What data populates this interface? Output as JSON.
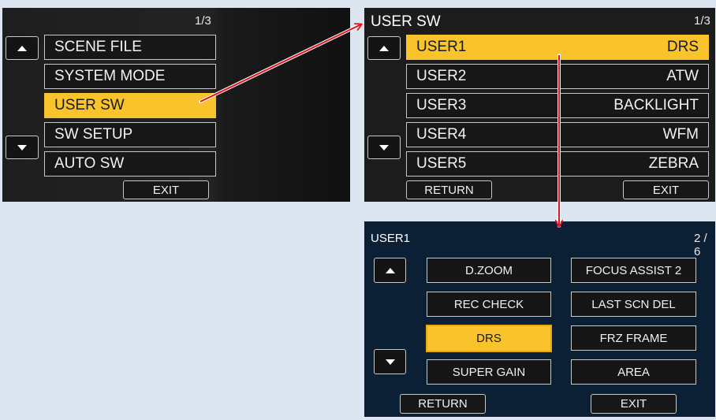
{
  "menu": {
    "page": "1/3",
    "items": [
      {
        "label": "SCENE FILE"
      },
      {
        "label": "SYSTEM MODE"
      },
      {
        "label": "USER SW"
      },
      {
        "label": "SW SETUP"
      },
      {
        "label": "AUTO SW"
      }
    ],
    "selected_index": 2,
    "exit_label": "EXIT",
    "up_icon": "triangle-up-icon",
    "down_icon": "triangle-down-icon"
  },
  "user_sw": {
    "title": "USER SW",
    "page": "1/3",
    "rows": [
      {
        "name": "USER1",
        "value": "DRS"
      },
      {
        "name": "USER2",
        "value": "ATW"
      },
      {
        "name": "USER3",
        "value": "BACKLIGHT"
      },
      {
        "name": "USER4",
        "value": "WFM"
      },
      {
        "name": "USER5",
        "value": "ZEBRA"
      }
    ],
    "selected_index": 0,
    "return_label": "RETURN",
    "exit_label": "EXIT"
  },
  "user1": {
    "title": "USER1",
    "page": "2 / 6",
    "left_items": [
      {
        "label": "D.ZOOM"
      },
      {
        "label": "REC CHECK"
      },
      {
        "label": "DRS"
      },
      {
        "label": "SUPER GAIN"
      }
    ],
    "right_items": [
      {
        "label": "FOCUS ASSIST 2"
      },
      {
        "label": "LAST SCN DEL"
      },
      {
        "label": "FRZ FRAME"
      },
      {
        "label": "AREA"
      }
    ],
    "selected": "DRS",
    "return_label": "RETURN",
    "exit_label": "EXIT"
  },
  "colors": {
    "highlight": "#f9c32b",
    "arrow": "#e0141e",
    "page_bg": "#dce6f1"
  }
}
